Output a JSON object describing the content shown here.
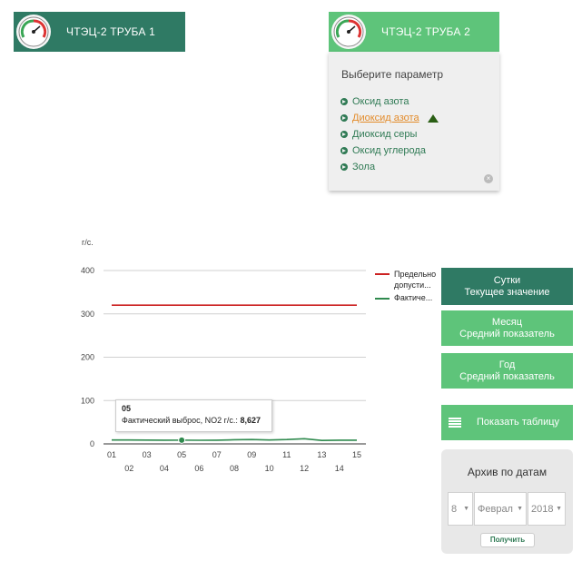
{
  "tubes": [
    {
      "label": "ЧТЭЦ-2 ТРУБА 1"
    },
    {
      "label": "ЧТЭЦ-2 ТРУБА 2"
    }
  ],
  "param_panel": {
    "title": "Выберите параметр",
    "items": [
      {
        "label": "Оксид азота"
      },
      {
        "label": "Диоксид азота",
        "active": true
      },
      {
        "label": "Диоксид серы"
      },
      {
        "label": "Оксид углерода"
      },
      {
        "label": "Зола"
      }
    ]
  },
  "tooltip": {
    "day": "05",
    "label": "Фактический выброс, NO2 г/с.: ",
    "value": "8,627"
  },
  "legend": {
    "limit": "Предельно допусти...",
    "actual": "Фактиче..."
  },
  "side": {
    "day": {
      "line1": "Сутки",
      "line2": "Текущее значение"
    },
    "month": {
      "line1": "Месяц",
      "line2": "Средний показатель"
    },
    "year": {
      "line1": "Год",
      "line2": "Средний показатель"
    },
    "table": "Показать таблицу"
  },
  "archive": {
    "title": "Архив по датам",
    "day": "8",
    "month": "Феврал",
    "year": "2018",
    "get_label": "Получить"
  },
  "colors": {
    "dark_green": "#2f7a64",
    "light_green": "#5ec47a",
    "limit_line": "#cc2222",
    "actual_line": "#2f8a4e"
  },
  "chart_data": {
    "type": "line",
    "ylabel": "г/с.",
    "ylim": [
      0,
      400
    ],
    "yticks": [
      "0",
      "100",
      "200",
      "300",
      "400"
    ],
    "x": [
      "01",
      "02",
      "03",
      "04",
      "05",
      "06",
      "07",
      "08",
      "09",
      "10",
      "11",
      "12",
      "13",
      "14",
      "15"
    ],
    "series": [
      {
        "name": "Предельно допусти...",
        "values": [
          320,
          320,
          320,
          320,
          320,
          320,
          320,
          320,
          320,
          320,
          320,
          320,
          320,
          320,
          320
        ]
      },
      {
        "name": "Фактиче...",
        "values": [
          9,
          9,
          8.7,
          8.5,
          8.627,
          8.4,
          8.6,
          9.5,
          10,
          9,
          10,
          12,
          8,
          8.5,
          8.5
        ]
      }
    ],
    "highlight_index": 4
  }
}
